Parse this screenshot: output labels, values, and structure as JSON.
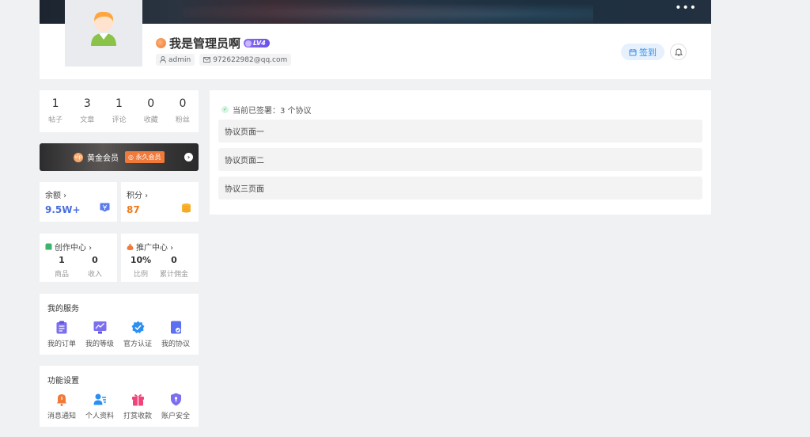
{
  "profile": {
    "name": "我是管理员啊",
    "level": "LV4",
    "username": "admin",
    "email": "972622982@qq.com",
    "signin_label": "签到"
  },
  "stats": [
    {
      "value": "1",
      "label": "帖子"
    },
    {
      "value": "3",
      "label": "文章"
    },
    {
      "value": "1",
      "label": "评论"
    },
    {
      "value": "0",
      "label": "收藏"
    },
    {
      "value": "0",
      "label": "粉丝"
    }
  ],
  "vip": {
    "label": "黄金会员",
    "badge": "永久会员",
    "icon_text": "vip"
  },
  "balance": {
    "title": "余额 ›",
    "value": "9.5W+",
    "color": "#4a6ee0"
  },
  "points": {
    "title": "积分 ›",
    "value": "87",
    "color": "#f07a1a"
  },
  "creator": {
    "title": "创作中心 ›",
    "items": [
      {
        "value": "1",
        "label": "商品"
      },
      {
        "value": "0",
        "label": "收入"
      }
    ]
  },
  "promo": {
    "title": "推广中心 ›",
    "items": [
      {
        "value": "10%",
        "label": "比例"
      },
      {
        "value": "0",
        "label": "累计佣金"
      }
    ]
  },
  "services": {
    "title": "我的服务",
    "items": [
      {
        "label": "我的订单",
        "icon": "clipboard-icon"
      },
      {
        "label": "我的等级",
        "icon": "chart-icon"
      },
      {
        "label": "官方认证",
        "icon": "verified-icon"
      },
      {
        "label": "我的协议",
        "icon": "document-icon"
      }
    ]
  },
  "settings": {
    "title": "功能设置",
    "items": [
      {
        "label": "消息通知",
        "icon": "bell-icon"
      },
      {
        "label": "个人资料",
        "icon": "user-card-icon"
      },
      {
        "label": "打赏收款",
        "icon": "gift-icon"
      },
      {
        "label": "账户安全",
        "icon": "shield-icon"
      }
    ]
  },
  "agreements": {
    "signed_text": "当前已签署：3 个协议",
    "items": [
      "协议页面一",
      "协议页面二",
      "协议三页面"
    ]
  }
}
